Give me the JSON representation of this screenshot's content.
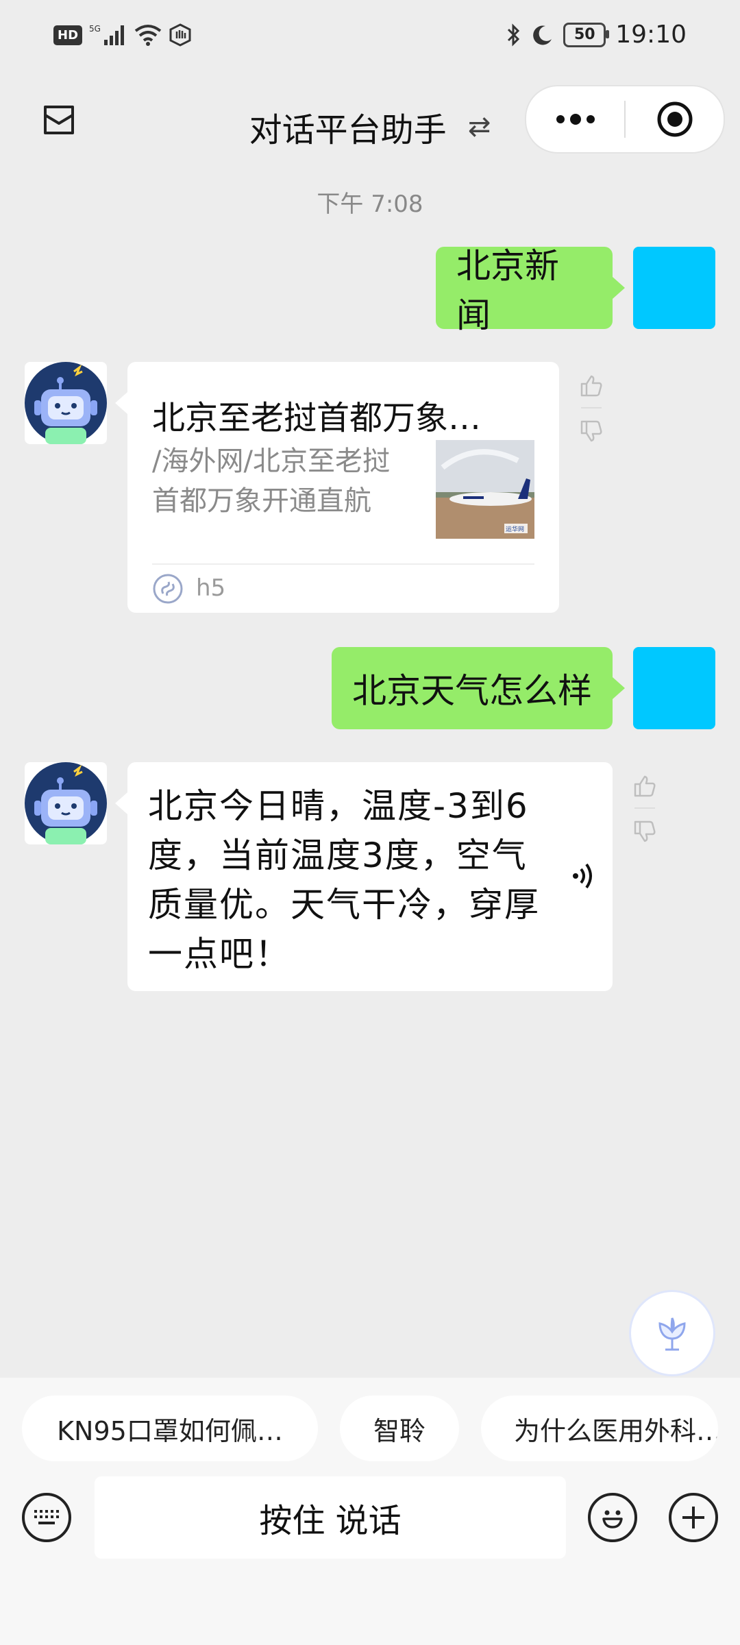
{
  "status_bar": {
    "left_icons": [
      "hd-icon",
      "5g-signal-icon",
      "wifi-icon",
      "hand-icon"
    ],
    "hd_label": "HD",
    "battery": "50",
    "time": "19:10"
  },
  "header": {
    "title": "对话平台助手",
    "switch_glyph": "⇄"
  },
  "chat": {
    "timestamp": "下午 7:08",
    "messages": [
      {
        "from": "user",
        "text": "北京新闻"
      },
      {
        "from": "bot",
        "type": "card",
        "title": "北京至老挝首都万象…",
        "desc_line1": "/海外网/北京至老挝",
        "desc_line2": "首都万象开通直航",
        "source": "h5",
        "thumb_watermark": "运华网"
      },
      {
        "from": "user",
        "text": "北京天气怎么样"
      },
      {
        "from": "bot",
        "type": "text",
        "lines": [
          "北京今日晴，温度-3到6",
          "度，当前温度3度，空气",
          "质量优。天气干冷，穿厚",
          "一点吧！"
        ]
      }
    ]
  },
  "suggestions": [
    "KN95口罩如何佩…",
    "智聆",
    "为什么医用外科…"
  ],
  "input": {
    "talk_label": "按住 说话"
  },
  "colors": {
    "user_bubble": "#95ec69",
    "user_avatar": "#00c8ff",
    "background": "#ededed"
  }
}
